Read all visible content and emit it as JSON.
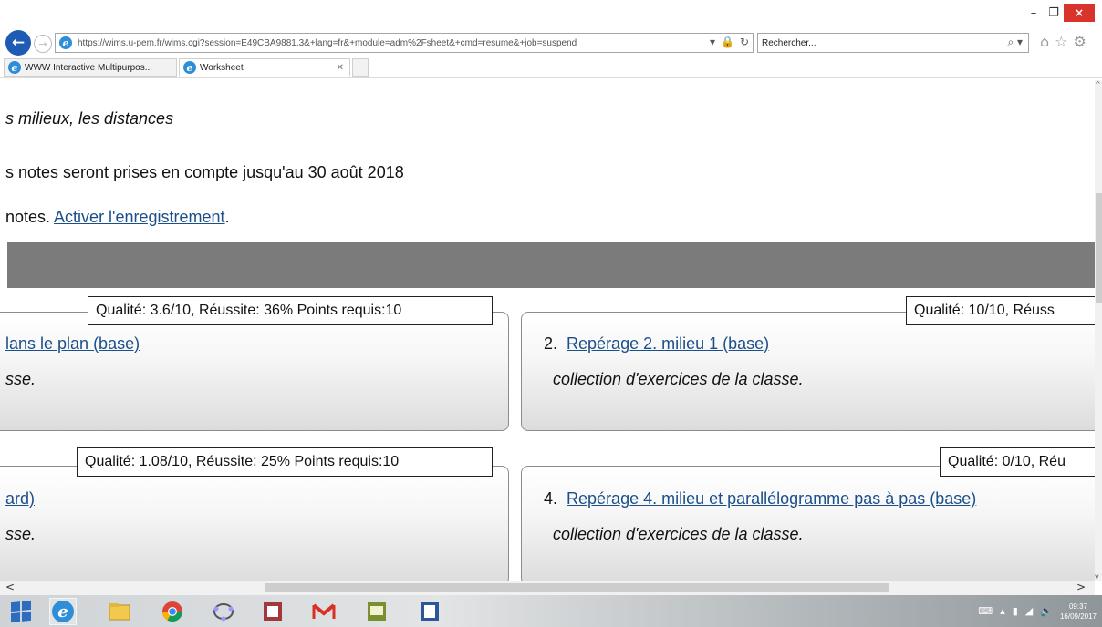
{
  "window": {
    "minimize_glyph": "–",
    "restore_glyph": "❐",
    "close_glyph": "×"
  },
  "navigation": {
    "url": "https://wims.u-pem.fr/wims.cgi?session=E49CBA9881.3&+lang=fr&+module=adm%2Fsheet&+cmd=resume&+job=suspend",
    "search_placeholder": "Rechercher..."
  },
  "tabs": [
    {
      "label": "WWW Interactive Multipurpos...",
      "active": false
    },
    {
      "label": "Worksheet",
      "active": true
    }
  ],
  "page": {
    "subtitle": "s milieux, les distances",
    "notice": "s notes seront prises en compte jusqu'au 30 août 2018",
    "record_prefix": "notes. ",
    "record_link": "Activer l'enregistrement",
    "record_suffix": "."
  },
  "exercises": [
    {
      "badge": "Qualité: 3.6/10, Réussite: 36% Points requis:10",
      "number": "",
      "title": "lans le plan (base)",
      "desc": "sse."
    },
    {
      "badge": "Qualité: 10/10, Réuss",
      "number": "2.",
      "title": "Repérage 2. milieu 1 (base)",
      "desc": "collection d'exercices de la classe."
    },
    {
      "badge": "Qualité: 1.08/10, Réussite: 25% Points requis:10",
      "number": "",
      "title": "ard)",
      "desc": "sse."
    },
    {
      "badge": "Qualité: 0/10, Réu",
      "number": "4.",
      "title": "Repérage 4. milieu et parallélogramme pas à pas (base)",
      "desc": "collection d'exercices de la classe."
    }
  ],
  "taskbar": {
    "clock_time": "09:37",
    "clock_date": "16/09/2017"
  },
  "colors": {
    "link": "#1a4f8a",
    "header_bar": "#7b7b7b",
    "close_button": "#d9342b",
    "ie_blue": "#2f8ed8"
  }
}
